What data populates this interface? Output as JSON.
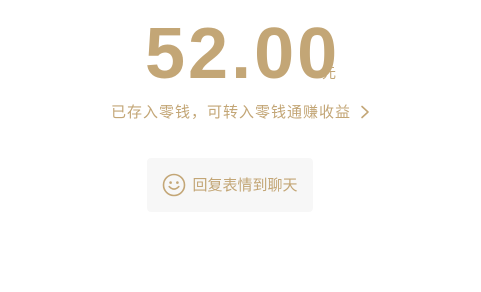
{
  "transfer": {
    "amount": "52.00",
    "currency_unit": "元",
    "hint_text": "已存入零钱，可转入零钱通赚收益",
    "hint_chevron_icon": "chevron-right-icon"
  },
  "reply_button": {
    "label": "回复表情到聊天",
    "icon": "smile-face-icon"
  },
  "colors": {
    "accent_gold": "#c3a676",
    "button_bg": "#f7f7f7",
    "background": "#ffffff"
  }
}
